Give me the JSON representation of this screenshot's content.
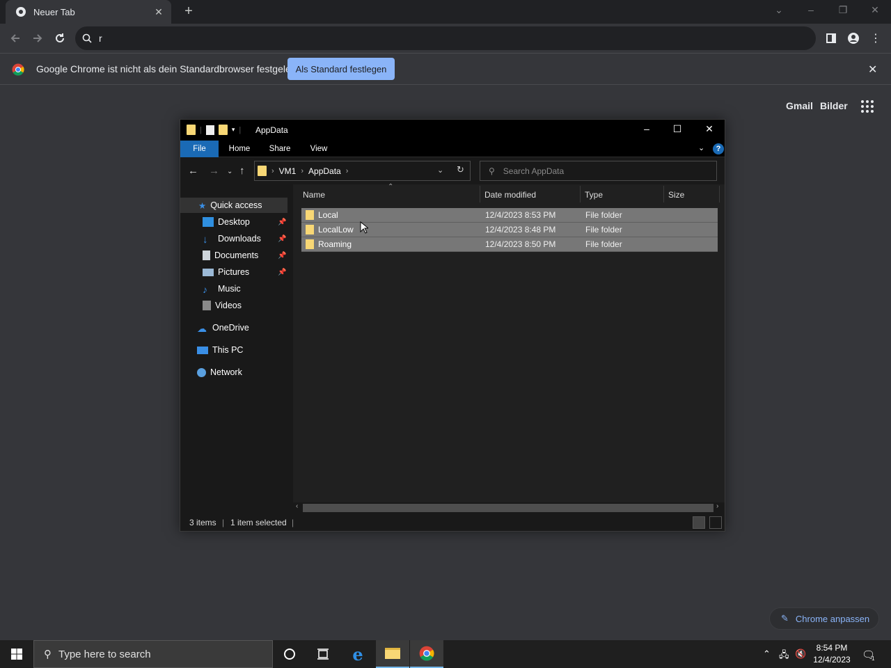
{
  "browser": {
    "tab_title": "Neuer Tab",
    "omnibox_text": "r"
  },
  "infobar": {
    "message": "Google Chrome ist nicht als dein Standardbrowser festgelegt",
    "button": "Als Standard festlegen"
  },
  "ntp": {
    "links": [
      "Gmail",
      "Bilder"
    ],
    "customize": "Chrome anpassen"
  },
  "explorer": {
    "title": "AppData",
    "ribbon_tabs": [
      "File",
      "Home",
      "Share",
      "View"
    ],
    "breadcrumb": [
      "VM1",
      "AppData"
    ],
    "search_placeholder": "Search AppData",
    "nav": {
      "quick_access": "Quick access",
      "items": [
        "Desktop",
        "Downloads",
        "Documents",
        "Pictures",
        "Music",
        "Videos"
      ],
      "onedrive": "OneDrive",
      "this_pc": "This PC",
      "network": "Network"
    },
    "columns": [
      "Name",
      "Date modified",
      "Type",
      "Size"
    ],
    "rows": [
      {
        "name": "Local",
        "date": "12/4/2023 8:53 PM",
        "type": "File folder"
      },
      {
        "name": "LocalLow",
        "date": "12/4/2023 8:48 PM",
        "type": "File folder"
      },
      {
        "name": "Roaming",
        "date": "12/4/2023 8:50 PM",
        "type": "File folder"
      }
    ],
    "status": {
      "items": "3 items",
      "selected": "1 item selected"
    }
  },
  "taskbar": {
    "search_placeholder": "Type here to search",
    "time": "8:54 PM",
    "date": "12/4/2023",
    "notification_count": "1"
  },
  "colors": {
    "accent": "#8ab4f8",
    "explorer_file_tab": "#1a6ab5",
    "folder": "#f8d775"
  }
}
